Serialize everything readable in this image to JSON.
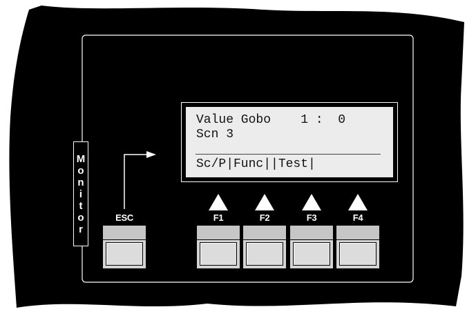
{
  "display": {
    "line1": "Value Gobo    1 :  0",
    "line2": "Scn 3",
    "line3": "Sc/P|Func||Test|"
  },
  "side_label": [
    "M",
    "o",
    "n",
    "i",
    "t",
    "o",
    "r"
  ],
  "keys": {
    "esc": "ESC",
    "f1": "F1",
    "f2": "F2",
    "f3": "F3",
    "f4": "F4"
  },
  "colors": {
    "panel": "#000000",
    "display_bg": "#ececec",
    "key_bg": "#d4d4d4",
    "label": "#ffffff"
  }
}
